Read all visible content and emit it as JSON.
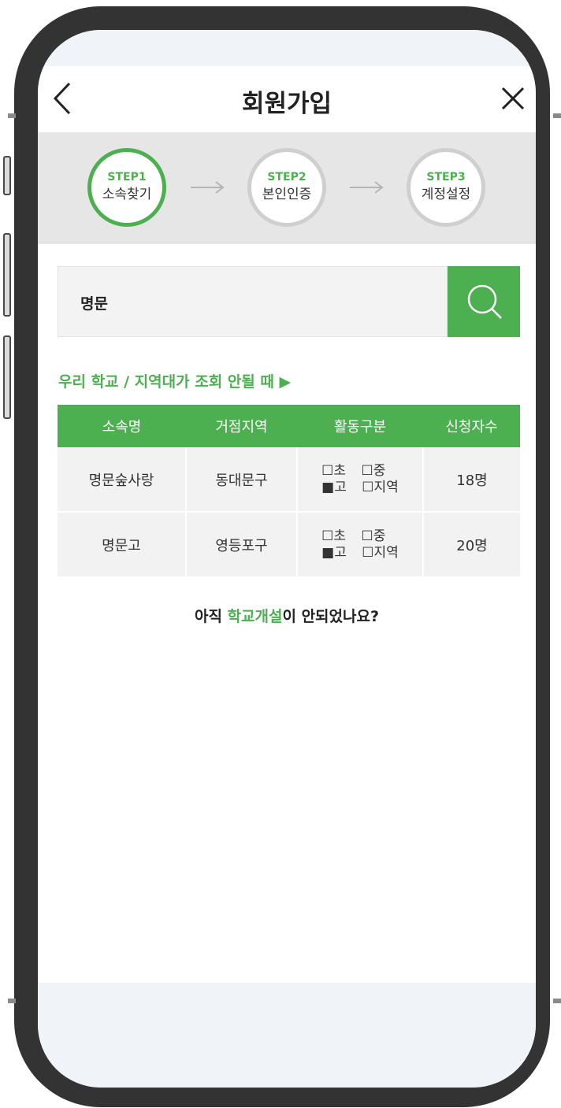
{
  "header": {
    "title": "회원가입"
  },
  "steps": [
    {
      "num": "STEP1",
      "name": "소속찾기"
    },
    {
      "num": "STEP2",
      "name": "본인인증"
    },
    {
      "num": "STEP3",
      "name": "계정설정"
    }
  ],
  "search": {
    "value": "명문"
  },
  "help_link": "우리 학교 / 지역대가 조회 안될 때 ▶",
  "table": {
    "headers": [
      "소속명",
      "거점지역",
      "활동구분",
      "신청자수"
    ],
    "rows": [
      {
        "name": "명문숲사랑",
        "region": "동대문구",
        "cats": {
          "a": "☐초",
          "b": "☐중",
          "c": "■고",
          "d": "☐지역"
        },
        "count": "18명"
      },
      {
        "name": "명문고",
        "region": "영등포구",
        "cats": {
          "a": "☐초",
          "b": "☐중",
          "c": "■고",
          "d": "☐지역"
        },
        "count": "20명"
      }
    ]
  },
  "school_open": {
    "prefix": "아직 ",
    "link": "학교개설",
    "suffix": "이 안되었나요?"
  },
  "colors": {
    "accent": "#4caf50",
    "frame": "#333333",
    "header_bar": "#e6e6e6"
  },
  "icons": {
    "back": "chevron-left-icon",
    "close": "close-icon",
    "search": "search-icon",
    "arrow": "arrow-right-icon"
  }
}
